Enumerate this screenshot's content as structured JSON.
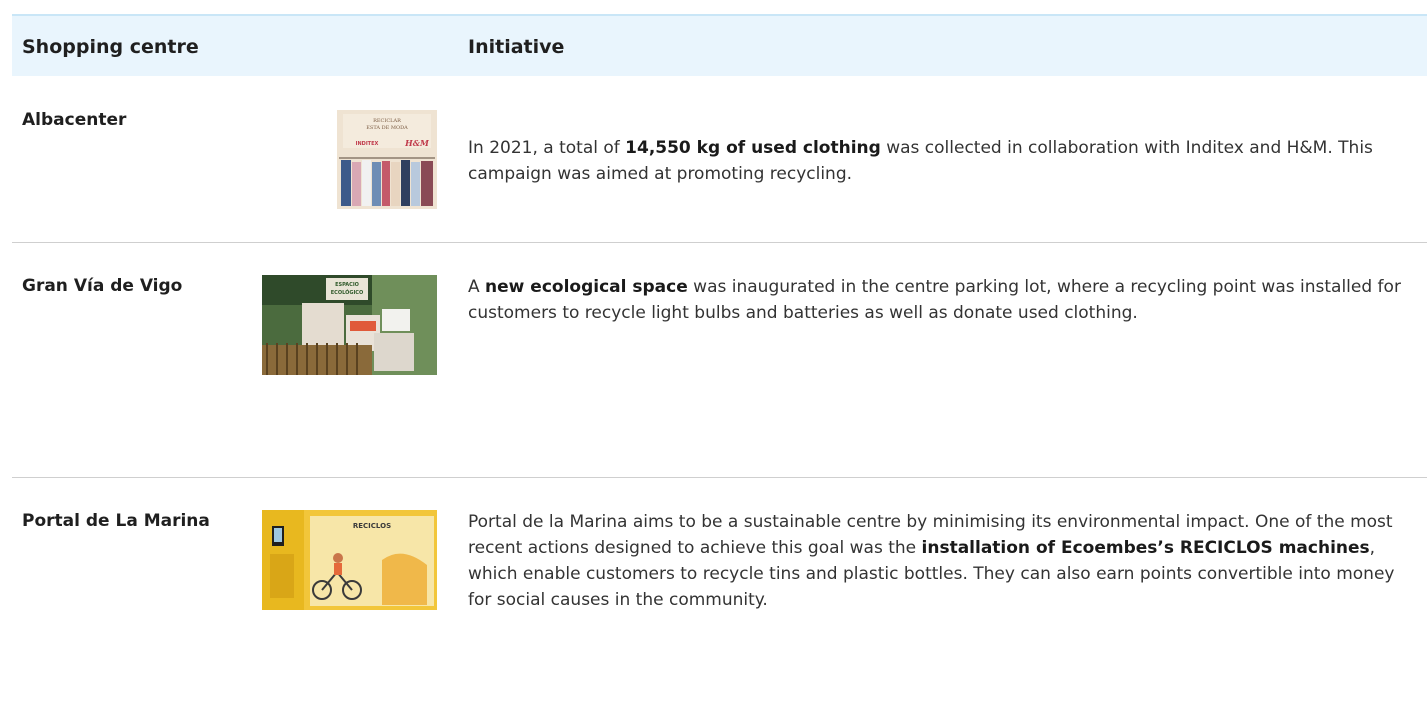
{
  "table": {
    "headers": {
      "centre": "Shopping centre",
      "initiative": "Initiative"
    },
    "rows": [
      {
        "name": "Albacenter",
        "parts": [
          {
            "t": "In 2021, a total of "
          },
          {
            "t": "14,550 kg of used clothing",
            "b": true
          },
          {
            "t": " was collected in collaboration with Inditex and H&M. This campaign was aimed at promoting recycling."
          }
        ],
        "photo_text": [
          "RECICLAR",
          "ESTA DE MODA",
          "INDITEX",
          "H&M"
        ]
      },
      {
        "name": "Gran Vía de Vigo",
        "parts": [
          {
            "t": "A "
          },
          {
            "t": "new ecological space",
            "b": true
          },
          {
            "t": " was inaugurated in the centre parking lot, where a recycling point was installed for customers to recycle light bulbs and batteries as well as donate used clothing."
          }
        ],
        "photo_text": [
          "ESPACIO",
          "ECOLÓGICO"
        ]
      },
      {
        "name": "Portal de La Marina",
        "parts": [
          {
            "t": "Portal de la Marina aims to be a sustainable centre by minimising its environmental impact. One of the most recent actions designed to achieve this goal was the "
          },
          {
            "t": "installation of Ecoembes’s RECICLOS machines",
            "b": true
          },
          {
            "t": ", which enable customers to recycle tins and plastic bottles. They can also earn points convertible into money for social causes in the community."
          }
        ],
        "photo_text": [
          "RECICLOS"
        ]
      }
    ]
  }
}
